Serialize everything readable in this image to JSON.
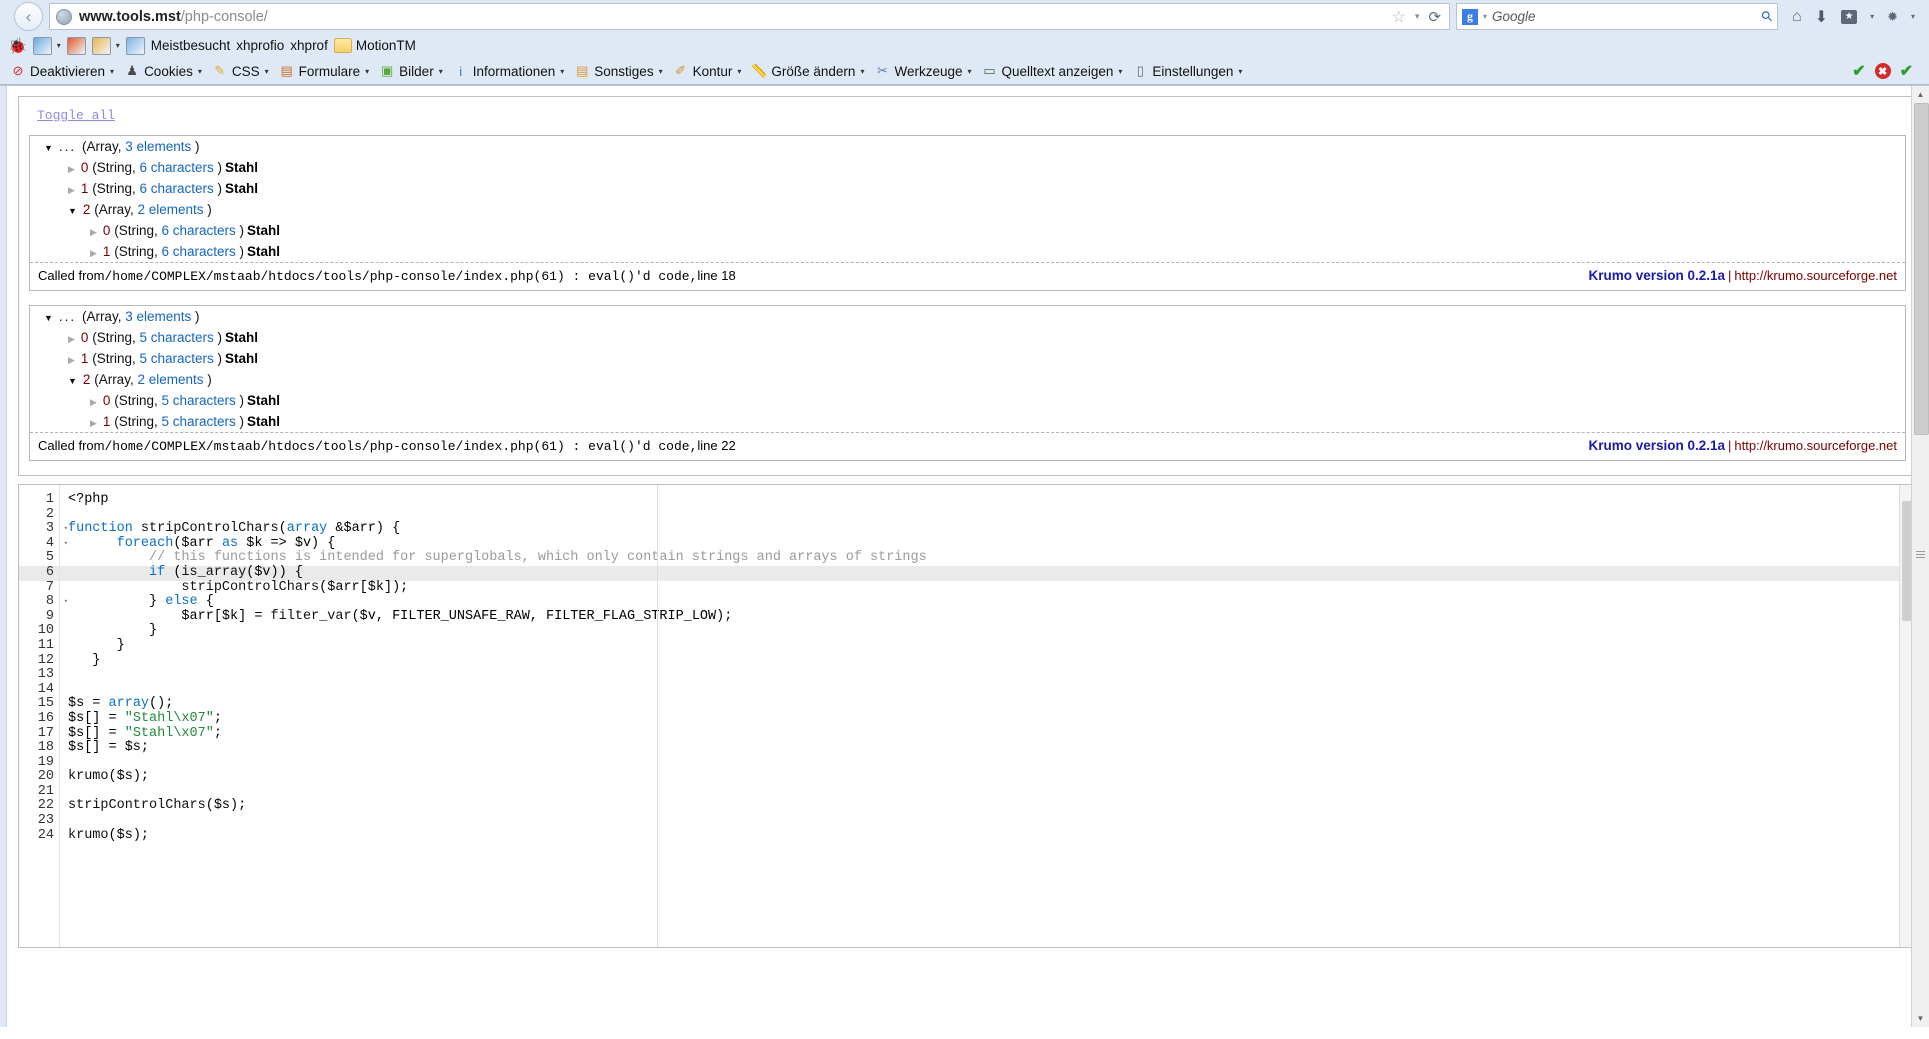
{
  "browser": {
    "back_label": "‹",
    "url_bold": "www.tools.mst",
    "url_rest": "/php-console/",
    "star_icon": "☆",
    "dropdown_icon": "▾",
    "reload_icon": "⟳",
    "search_engine_badge": "g",
    "search_placeholder": "Google",
    "search_icon": "⚲",
    "home_icon": "⌂",
    "download_icon": "⬇",
    "bookmark_icon": "★",
    "addon_icon": "✹"
  },
  "bookmarks": {
    "items": [
      {
        "label": "",
        "icon": "bug-icon",
        "color": "#3aa03a"
      },
      {
        "label": "",
        "icon": "image-icon",
        "color": "#6aa9e0",
        "has_arrow": true
      },
      {
        "label": "",
        "icon": "chart-icon",
        "color": "#e05a2b"
      },
      {
        "label": "",
        "icon": "table-icon",
        "color": "#e8b64c",
        "has_arrow": true
      },
      {
        "label": "",
        "icon": "inspect-icon",
        "color": "#7fb3e8"
      },
      {
        "label": "Meistbesucht",
        "icon": "bookmark-text"
      },
      {
        "label": "xhprofio",
        "icon": "bookmark-text"
      },
      {
        "label": "xhprof",
        "icon": "bookmark-text"
      },
      {
        "label": "MotionTM",
        "icon": "folder-icon"
      }
    ]
  },
  "devtoolbar": {
    "items": [
      {
        "label": "Deaktivieren",
        "icon": "disable-icon",
        "glyph": "⊘",
        "color": "#cc2b2b"
      },
      {
        "label": "Cookies",
        "icon": "cookie-icon",
        "glyph": "♟",
        "color": "#4a4a4a"
      },
      {
        "label": "CSS",
        "icon": "css-icon",
        "glyph": "✎",
        "color": "#e0b020"
      },
      {
        "label": "Formulare",
        "icon": "forms-icon",
        "glyph": "▤",
        "color": "#d06b2b"
      },
      {
        "label": "Bilder",
        "icon": "images-icon",
        "glyph": "▣",
        "color": "#5aa83a"
      },
      {
        "label": "Informationen",
        "icon": "info-icon",
        "glyph": "i",
        "color": "#2b7fd0"
      },
      {
        "label": "Sonstiges",
        "icon": "misc-icon",
        "glyph": "▤",
        "color": "#e09a2b"
      },
      {
        "label": "Kontur",
        "icon": "outline-icon",
        "glyph": "✐",
        "color": "#d0902b"
      },
      {
        "label": "Größe ändern",
        "icon": "resize-icon",
        "glyph": "📏",
        "color": "#d0902b"
      },
      {
        "label": "Werkzeuge",
        "icon": "tools-icon",
        "glyph": "✂",
        "color": "#5a7fa8"
      },
      {
        "label": "Quelltext anzeigen",
        "icon": "source-icon",
        "glyph": "▭",
        "color": "#3a6a3a"
      },
      {
        "label": "Einstellungen",
        "icon": "settings-icon",
        "glyph": "▯",
        "color": "#6a6a6a"
      }
    ],
    "status": {
      "valid_icon": "✔",
      "error_icon": "✖",
      "check_icon": "✔"
    }
  },
  "krumo": {
    "toggle_all": "Toggle all",
    "blocks": [
      {
        "nodes": [
          {
            "level": 1,
            "state": "open",
            "name": "...",
            "type": "Array",
            "count": "3 elements",
            "value": ""
          },
          {
            "level": 2,
            "state": "closed",
            "name": "0",
            "type": "String",
            "count": "6 characters",
            "value": "Stahl"
          },
          {
            "level": 2,
            "state": "closed",
            "name": "1",
            "type": "String",
            "count": "6 characters",
            "value": "Stahl"
          },
          {
            "level": 2,
            "state": "open",
            "name": "2",
            "type": "Array",
            "count": "2 elements",
            "value": ""
          },
          {
            "level": 3,
            "state": "closed",
            "name": "0",
            "type": "String",
            "count": "6 characters",
            "value": "Stahl"
          },
          {
            "level": 3,
            "state": "closed",
            "name": "1",
            "type": "String",
            "count": "6 characters",
            "value": "Stahl"
          }
        ],
        "called_from_label": "Called from",
        "called_from_path": "/home/COMPLEX/mstaab/htdocs/tools/php-console/index.php(61)  :  eval()'d code,",
        "line_label": "line 18",
        "version": "Krumo version 0.2.1a",
        "separator": "|",
        "link": "http://krumo.sourceforge.net"
      },
      {
        "nodes": [
          {
            "level": 1,
            "state": "open",
            "name": "...",
            "type": "Array",
            "count": "3 elements",
            "value": ""
          },
          {
            "level": 2,
            "state": "closed",
            "name": "0",
            "type": "String",
            "count": "5 characters",
            "value": "Stahl"
          },
          {
            "level": 2,
            "state": "closed",
            "name": "1",
            "type": "String",
            "count": "5 characters",
            "value": "Stahl"
          },
          {
            "level": 2,
            "state": "open",
            "name": "2",
            "type": "Array",
            "count": "2 elements",
            "value": ""
          },
          {
            "level": 3,
            "state": "closed",
            "name": "0",
            "type": "String",
            "count": "5 characters",
            "value": "Stahl"
          },
          {
            "level": 3,
            "state": "closed",
            "name": "1",
            "type": "String",
            "count": "5 characters",
            "value": "Stahl"
          }
        ],
        "called_from_label": "Called from",
        "called_from_path": "/home/COMPLEX/mstaab/htdocs/tools/php-console/index.php(61)  :  eval()'d code,",
        "line_label": "line 22",
        "version": "Krumo version 0.2.1a",
        "separator": "|",
        "link": "http://krumo.sourceforge.net"
      }
    ]
  },
  "editor": {
    "active_line": 6,
    "fold_lines": [
      3,
      4,
      6,
      8
    ],
    "lines": [
      {
        "n": 1,
        "text": "<?php"
      },
      {
        "n": 2,
        "text": ""
      },
      {
        "n": 3,
        "text": "function stripControlChars(array &$arr) {"
      },
      {
        "n": 4,
        "text": "      foreach($arr as $k => $v) {"
      },
      {
        "n": 5,
        "text": "          // this functions is intended for superglobals, which only contain strings and arrays of strings"
      },
      {
        "n": 6,
        "text": "          if (is_array($v)) {"
      },
      {
        "n": 7,
        "text": "              stripControlChars($arr[$k]);"
      },
      {
        "n": 8,
        "text": "          } else {"
      },
      {
        "n": 9,
        "text": "              $arr[$k] = filter_var($v, FILTER_UNSAFE_RAW, FILTER_FLAG_STRIP_LOW);"
      },
      {
        "n": 10,
        "text": "          }"
      },
      {
        "n": 11,
        "text": "      }"
      },
      {
        "n": 12,
        "text": "   }"
      },
      {
        "n": 13,
        "text": ""
      },
      {
        "n": 14,
        "text": ""
      },
      {
        "n": 15,
        "text": "$s = array();"
      },
      {
        "n": 16,
        "text": "$s[] = \"Stahl\\x07\";"
      },
      {
        "n": 17,
        "text": "$s[] = \"Stahl\\x07\";"
      },
      {
        "n": 18,
        "text": "$s[] = $s;"
      },
      {
        "n": 19,
        "text": ""
      },
      {
        "n": 20,
        "text": "krumo($s);"
      },
      {
        "n": 21,
        "text": ""
      },
      {
        "n": 22,
        "text": "stripControlChars($s);"
      },
      {
        "n": 23,
        "text": ""
      },
      {
        "n": 24,
        "text": "krumo($s);"
      }
    ]
  },
  "scrollbar": {
    "up_arrow": "▲",
    "down_arrow": "▼"
  }
}
